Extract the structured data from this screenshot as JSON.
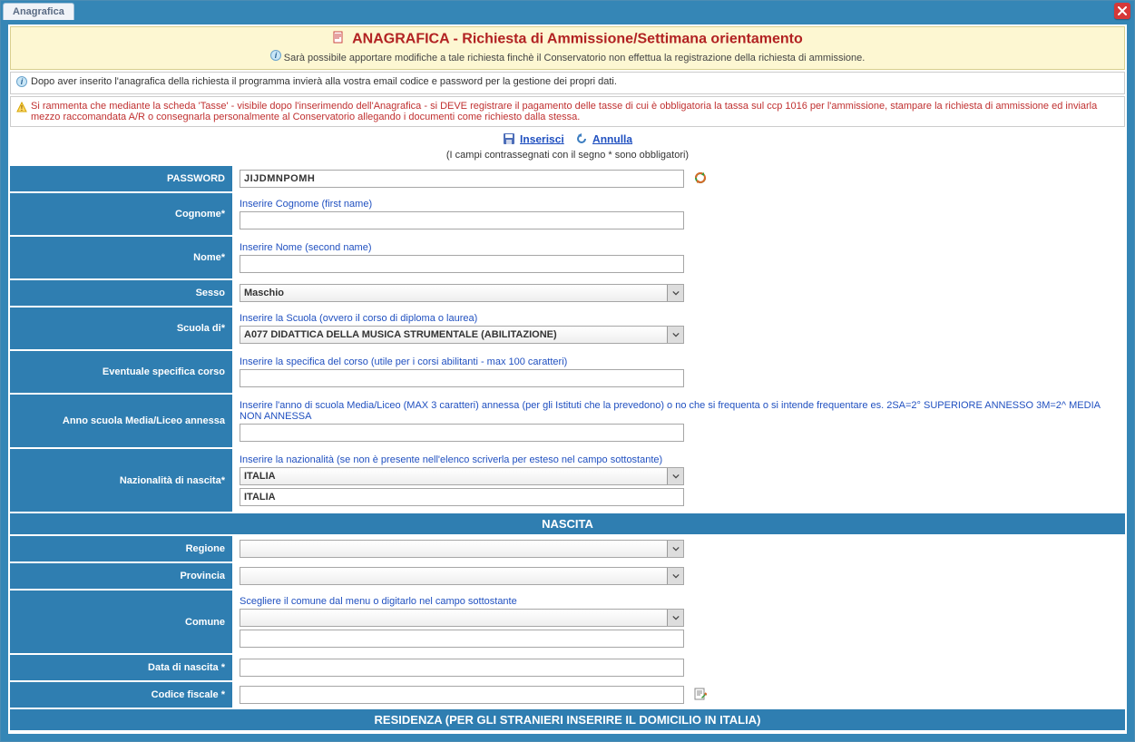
{
  "tab": {
    "label": "Anagrafica"
  },
  "header": {
    "title": "ANAGRAFICA - Richiesta di Ammissione/Settimana orientamento",
    "sub": "Sarà possibile apportare modifiche a tale richiesta finchè il Conservatorio non effettua la registrazione della richiesta di ammissione."
  },
  "info": {
    "text1": "Dopo aver inserito l'anagrafica della richiesta il programma invierà alla vostra email codice e password per la gestione dei propri dati.",
    "warn": "Si rammenta che mediante la scheda 'Tasse' - visibile dopo l'inserimendo dell'Anagrafica - si DEVE registrare il pagamento delle tasse di cui è obbligatoria la tassa sul ccp 1016 per l'ammissione, stampare la richiesta di ammissione ed inviarla mezzo raccomandata A/R o consegnarla personalmente al Conservatorio allegando i documenti come richiesto dalla stessa."
  },
  "actions": {
    "inserisci": "Inserisci",
    "annulla": "Annulla",
    "campi_note": "(I campi contrassegnati con il segno * sono obbligatori)"
  },
  "labels": {
    "password": "PASSWORD",
    "cognome": "Cognome*",
    "nome": "Nome*",
    "sesso": "Sesso",
    "scuola": "Scuola di*",
    "specifica": "Eventuale specifica corso",
    "anno_annessa": "Anno scuola Media/Liceo annessa",
    "nazionalita": "Nazionalità di nascita*",
    "regione": "Regione",
    "provincia": "Provincia",
    "comune": "Comune",
    "data_nascita": "Data di nascita *",
    "codice_fiscale": "Codice fiscale *"
  },
  "hints": {
    "cognome": "Inserire Cognome (first name)",
    "nome": "Inserire Nome (second name)",
    "scuola": "Inserire la Scuola (ovvero il corso di diploma o laurea)",
    "specifica": "Inserire la specifica del corso (utile per i corsi abilitanti - max 100 caratteri)",
    "anno_annessa": "Inserire l'anno di scuola Media/Liceo (MAX 3 caratteri) annessa (per gli Istituti che la prevedono) o no che si frequenta o si intende frequentare es. 2SA=2° SUPERIORE ANNESSO 3M=2^ MEDIA NON ANNESSA",
    "nazionalita": "Inserire la nazionalità (se non è presente nell'elenco scriverla per esteso nel campo sottostante)",
    "comune": "Scegliere il comune dal menu o digitarlo nel campo sottostante"
  },
  "values": {
    "password": "JIJDMNPOMH",
    "sesso": "Maschio",
    "scuola": "A077 DIDATTICA DELLA MUSICA STRUMENTALE (ABILITAZIONE)",
    "nazionalita_select": "ITALIA",
    "nazionalita_text": "ITALIA",
    "cognome": "",
    "nome": "",
    "specifica": "",
    "anno_annessa": "",
    "regione": "",
    "provincia": "",
    "comune_select": "",
    "comune_text": "",
    "data_nascita": "",
    "codice_fiscale": ""
  },
  "sections": {
    "nascita": "NASCITA",
    "residenza": "RESIDENZA (PER GLI STRANIERI INSERIRE IL DOMICILIO IN ITALIA)"
  }
}
